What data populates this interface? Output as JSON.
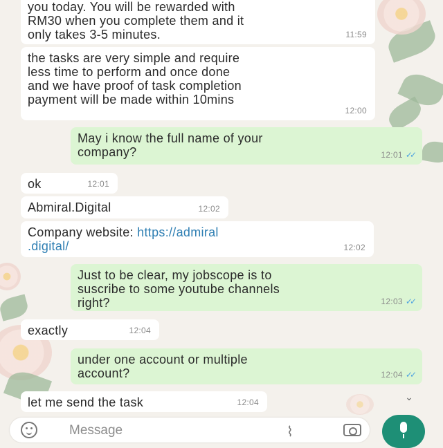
{
  "messages": [
    {
      "text": "you today. You will be rewarded with\nRM30 when you complete them and it\nonly takes 3-5 minutes.",
      "time": "11:59",
      "dir": "in"
    },
    {
      "text": "the tasks are very simple and require\nless time to perform and once done\nand we have proof of task completion\npayment will be made within 10mins",
      "time": "12:00",
      "dir": "in"
    },
    {
      "text": "May i know the full name of your\ncompany?",
      "time": "12:01",
      "dir": "out"
    },
    {
      "text": "ok",
      "time": "12:01",
      "dir": "in"
    },
    {
      "text": "Abmiral.Digital",
      "time": "12:02",
      "dir": "in"
    },
    {
      "text_prefix": "Company website: ",
      "link": "https://admiral\n.digital/",
      "time": "12:02",
      "dir": "in"
    },
    {
      "text": "Just to be clear, my jobscope is to\nsuscribe to some youtube channels\nright?",
      "time": "12:03",
      "dir": "out"
    },
    {
      "text": "exactly",
      "time": "12:04",
      "dir": "in"
    },
    {
      "text": "under one account or multiple\naccount?",
      "time": "12:04",
      "dir": "out"
    },
    {
      "text": "let me send the task",
      "time": "12:04",
      "dir": "in"
    }
  ],
  "composer": {
    "placeholder": "Message",
    "icons": [
      "emoji-icon",
      "attach-icon",
      "camera-icon",
      "mic-icon"
    ]
  },
  "scroll_icon": "chevron-down-icon",
  "colors": {
    "outgoing_bubble": "#dcf5d3",
    "incoming_bubble": "#ffffff",
    "read_ticks": "#4fa3e0",
    "link": "#2f7fb3",
    "mic_button": "#1e8f76"
  }
}
